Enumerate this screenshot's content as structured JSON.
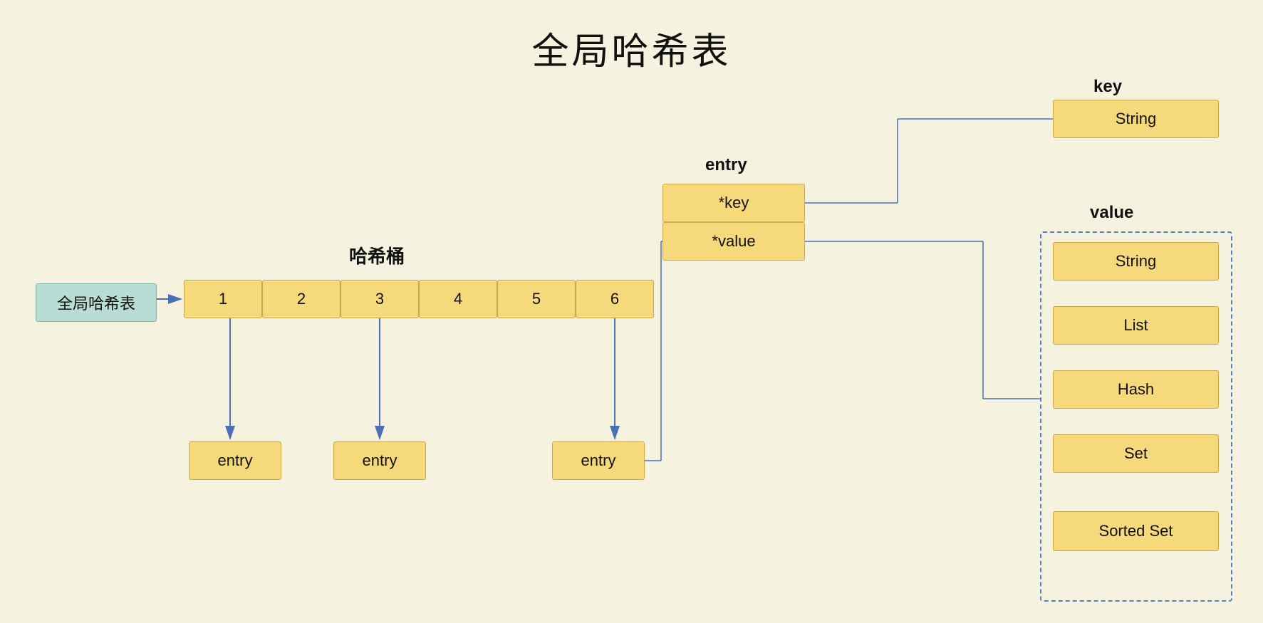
{
  "title": "全局哈希表",
  "global_hashtable_label": "全局哈希表",
  "hash_bucket_label": "哈希桶",
  "entry_label": "entry",
  "key_label": "key",
  "value_label": "value",
  "bucket_cells": [
    "1",
    "2",
    "3",
    "4",
    "5",
    "6"
  ],
  "entry_key_field": "*key",
  "entry_value_field": "*value",
  "key_type": "String",
  "value_types": [
    "String",
    "List",
    "Hash",
    "Set",
    "Sorted Set"
  ],
  "entry_boxes": [
    "entry",
    "entry",
    "entry"
  ]
}
